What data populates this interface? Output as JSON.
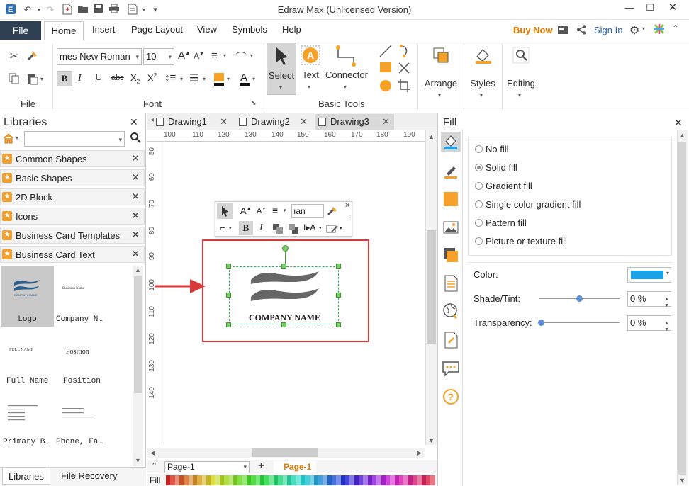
{
  "window": {
    "title": "Edraw Max (Unlicensed Version)",
    "buy_now": "Buy Now",
    "sign_in": "Sign In"
  },
  "menu": {
    "file": "File",
    "tabs": [
      "Home",
      "Insert",
      "Page Layout",
      "View",
      "Symbols",
      "Help"
    ]
  },
  "ribbon": {
    "groups": {
      "file": "File",
      "font": "Font",
      "basic_tools": "Basic Tools"
    },
    "font_name": "mes New Roman",
    "font_size": "10",
    "select_label": "Select",
    "text_label": "Text",
    "connector_label": "Connector",
    "arrange_label": "Arrange",
    "styles_label": "Styles",
    "editing_label": "Editing"
  },
  "libraries": {
    "title": "Libraries",
    "items": [
      "Common Shapes",
      "Basic Shapes",
      "2D Block",
      "Icons",
      "Business Card Templates",
      "Business Card Text"
    ],
    "shapes": [
      {
        "label": "Logo"
      },
      {
        "label": "Company N…",
        "preview": "Business Name"
      },
      {
        "label": "",
        "preview": "FULL NAME"
      },
      {
        "label": "",
        "preview": "Position"
      },
      {
        "label": "Full Name"
      },
      {
        "label": "Position"
      },
      {
        "label": "Primary B…"
      },
      {
        "label": "Phone, Fa…"
      }
    ],
    "bottom_tabs": [
      "Libraries",
      "File Recovery"
    ]
  },
  "documents": {
    "tabs": [
      "Drawing1",
      "Drawing2",
      "Drawing3"
    ],
    "active": "Drawing3"
  },
  "ruler": {
    "h": [
      "100",
      "110",
      "120",
      "130",
      "140",
      "150",
      "160",
      "170",
      "180",
      "190"
    ],
    "v": [
      "50",
      "60",
      "70",
      "80",
      "90",
      "100",
      "110",
      "120",
      "130",
      "140"
    ]
  },
  "canvas": {
    "company_name": "COMPANY NAME",
    "mini_toolbar_font": "ıan"
  },
  "fill_panel": {
    "title": "Fill",
    "options": [
      {
        "label": "No fill",
        "selected": false
      },
      {
        "label": "Solid fill",
        "selected": true
      },
      {
        "label": "Gradient fill",
        "selected": false
      },
      {
        "label": "Single color gradient fill",
        "selected": false
      },
      {
        "label": "Pattern fill",
        "selected": false
      },
      {
        "label": "Picture or texture fill",
        "selected": false
      }
    ],
    "color_label": "Color:",
    "color_value": "#1aa3e8",
    "shade_label": "Shade/Tint:",
    "shade_value": "0 %",
    "transparency_label": "Transparency:",
    "transparency_value": "0 %"
  },
  "pages": {
    "current": "Page-1",
    "tab": "Page-1",
    "fill_label": "Fill"
  },
  "colors": {
    "accent_red": "#d63a3a",
    "file_tab": "#2f3f52",
    "buy_now": "#e07a00",
    "orange_shape": "#f5a12a"
  }
}
